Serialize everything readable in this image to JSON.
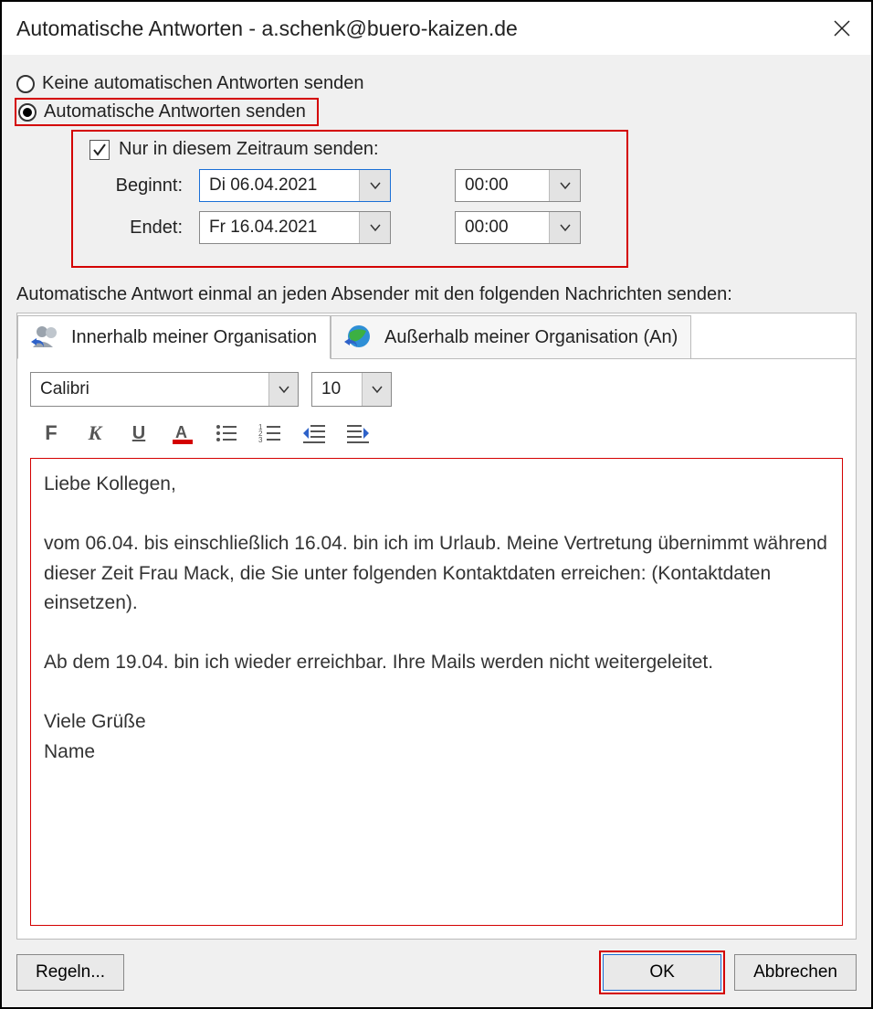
{
  "title": "Automatische Antworten - a.schenk@buero-kaizen.de",
  "radios": {
    "off_label": "Keine automatischen Antworten senden",
    "on_label": "Automatische Antworten senden"
  },
  "range": {
    "checkbox_label": "Nur in diesem Zeitraum senden:",
    "begin_label": "Beginnt:",
    "end_label": "Endet:",
    "begin_date": "Di 06.04.2021",
    "begin_time": "00:00",
    "end_date": "Fr 16.04.2021",
    "end_time": "00:00"
  },
  "instruction": "Automatische Antwort einmal an jeden Absender mit den folgenden Nachrichten senden:",
  "tabs": {
    "inside": "Innerhalb meiner Organisation",
    "outside": "Außerhalb meiner Organisation (An)"
  },
  "editor": {
    "font": "Calibri",
    "size": "10",
    "body": "Liebe Kollegen,\n\nvom 06.04. bis einschließlich 16.04. bin ich im Urlaub. Meine Vertretung übernimmt während dieser Zeit Frau Mack, die Sie unter folgenden Kontaktdaten erreichen: (Kontaktdaten einsetzen).\n\nAb dem 19.04. bin ich wieder erreichbar. Ihre Mails werden nicht weitergeleitet.\n\nViele Grüße\nName"
  },
  "footer": {
    "rules": "Regeln...",
    "ok": "OK",
    "cancel": "Abbrechen"
  }
}
